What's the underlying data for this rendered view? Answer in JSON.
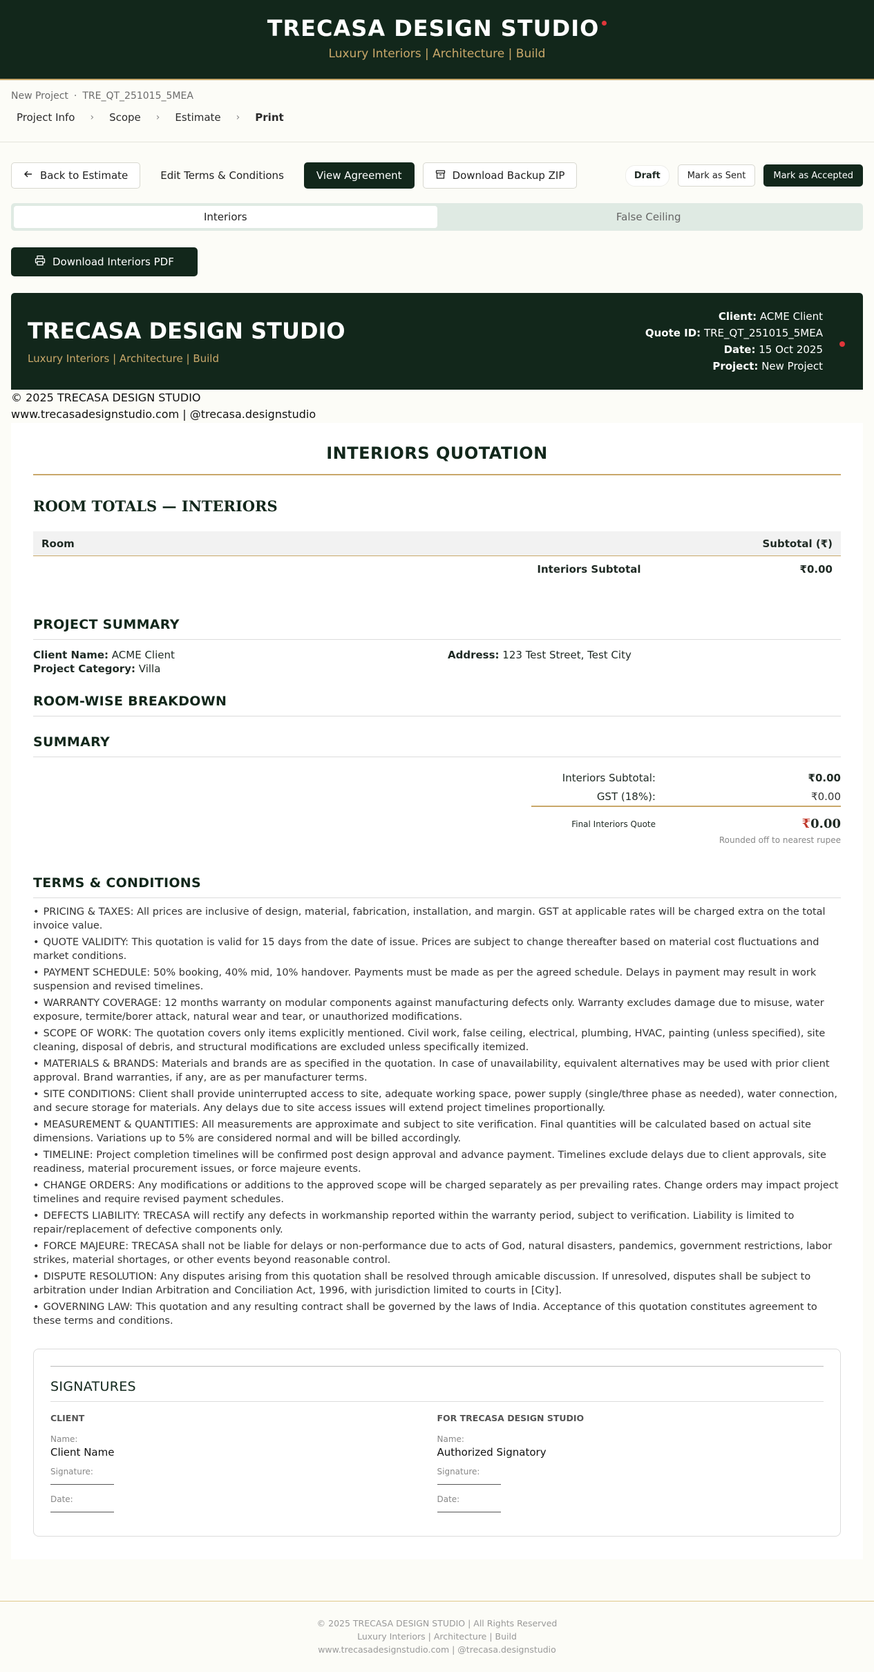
{
  "header": {
    "title": "TRECASA DESIGN STUDIO",
    "tagline": "Luxury Interiors | Architecture | Build"
  },
  "breadcrumb": {
    "project": "New Project",
    "separator": "·",
    "quote_id": "TRE_QT_251015_5MEA",
    "steps": [
      "Project Info",
      "Scope",
      "Estimate",
      "Print"
    ]
  },
  "toolbar": {
    "back": "Back to Estimate",
    "edit_terms": "Edit Terms & Conditions",
    "view_agreement": "View Agreement",
    "download_zip": "Download Backup ZIP",
    "status": "Draft",
    "mark_sent": "Mark as Sent",
    "mark_accepted": "Mark as Accepted"
  },
  "tabs": [
    "Interiors",
    "False Ceiling"
  ],
  "download_pdf": "Download Interiors PDF",
  "doc_header": {
    "title": "TRECASA DESIGN STUDIO",
    "tagline": "Luxury Interiors | Architecture | Build",
    "client_label": "Client:",
    "client": "ACME Client",
    "quote_label": "Quote ID:",
    "quote_id": "TRE_QT_251015_5MEA",
    "date_label": "Date:",
    "date": "15 Oct 2025",
    "project_label": "Project:",
    "project": "New Project",
    "copyright": "© 2025 TRECASA DESIGN STUDIO",
    "web": "www.trecasadesignstudio.com | @trecasa.designstudio"
  },
  "quote": {
    "title": "INTERIORS QUOTATION",
    "room_totals_heading": "ROOM TOTALS — INTERIORS",
    "col_room": "Room",
    "col_subtotal": "Subtotal (₹)",
    "subtotal_label": "Interiors Subtotal",
    "subtotal_value": "₹0.00"
  },
  "project_summary": {
    "title": "PROJECT SUMMARY",
    "client_name_label": "Client Name:",
    "client_name": "ACME Client",
    "category_label": "Project Category:",
    "category": "Villa",
    "address_label": "Address:",
    "address": "123 Test Street, Test City"
  },
  "room_breakdown": {
    "title": "ROOM-WISE BREAKDOWN"
  },
  "summary": {
    "title": "SUMMARY",
    "subtotal_label": "Interiors Subtotal:",
    "subtotal_value": "₹0.00",
    "gst_label": "GST (18%):",
    "gst_value": "₹0.00",
    "final_label": "Final Interiors Quote",
    "final_symbol": "₹",
    "final_value": "0.00",
    "rounded_note": "Rounded off to nearest rupee"
  },
  "terms": {
    "title": "TERMS & CONDITIONS",
    "items": [
      "PRICING & TAXES: All prices are inclusive of design, material, fabrication, installation, and margin. GST at applicable rates will be charged extra on the total invoice value.",
      "QUOTE VALIDITY: This quotation is valid for 15 days from the date of issue. Prices are subject to change thereafter based on material cost fluctuations and market conditions.",
      "PAYMENT SCHEDULE: 50% booking, 40% mid, 10% handover. Payments must be made as per the agreed schedule. Delays in payment may result in work suspension and revised timelines.",
      "WARRANTY COVERAGE: 12 months warranty on modular components against manufacturing defects only. Warranty excludes damage due to misuse, water exposure, termite/borer attack, natural wear and tear, or unauthorized modifications.",
      "SCOPE OF WORK: The quotation covers only items explicitly mentioned. Civil work, false ceiling, electrical, plumbing, HVAC, painting (unless specified), site cleaning, disposal of debris, and structural modifications are excluded unless specifically itemized.",
      "MATERIALS & BRANDS: Materials and brands are as specified in the quotation. In case of unavailability, equivalent alternatives may be used with prior client approval. Brand warranties, if any, are as per manufacturer terms.",
      "SITE CONDITIONS: Client shall provide uninterrupted access to site, adequate working space, power supply (single/three phase as needed), water connection, and secure storage for materials. Any delays due to site access issues will extend project timelines proportionally.",
      "MEASUREMENT & QUANTITIES: All measurements are approximate and subject to site verification. Final quantities will be calculated based on actual site dimensions. Variations up to 5% are considered normal and will be billed accordingly.",
      "TIMELINE: Project completion timelines will be confirmed post design approval and advance payment. Timelines exclude delays due to client approvals, site readiness, material procurement issues, or force majeure events.",
      "CHANGE ORDERS: Any modifications or additions to the approved scope will be charged separately as per prevailing rates. Change orders may impact project timelines and require revised payment schedules.",
      "DEFECTS LIABILITY: TRECASA will rectify any defects in workmanship reported within the warranty period, subject to verification. Liability is limited to repair/replacement of defective components only.",
      "FORCE MAJEURE: TRECASA shall not be liable for delays or non-performance due to acts of God, natural disasters, pandemics, government restrictions, labor strikes, material shortages, or other events beyond reasonable control.",
      "DISPUTE RESOLUTION: Any disputes arising from this quotation shall be resolved through amicable discussion. If unresolved, disputes shall be subject to arbitration under Indian Arbitration and Conciliation Act, 1996, with jurisdiction limited to courts in [City].",
      "GOVERNING LAW: This quotation and any resulting contract shall be governed by the laws of India. Acceptance of this quotation constitutes agreement to these terms and conditions."
    ]
  },
  "signatures": {
    "title": "SIGNATURES",
    "client_heading": "CLIENT",
    "studio_heading": "FOR TRECASA DESIGN STUDIO",
    "name_label": "Name:",
    "signature_label": "Signature:",
    "date_label": "Date:",
    "client_name": "Client Name",
    "studio_name": "Authorized Signatory"
  },
  "footer": {
    "line1": "© 2025 TRECASA DESIGN STUDIO | All Rights Reserved",
    "line2": "Luxury Interiors | Architecture | Build",
    "line3": "www.trecasadesignstudio.com | @trecasa.designstudio"
  },
  "colors": {
    "brand_dark": "#12271b",
    "gold": "#c9a86a",
    "accent_red": "#e0363a",
    "tab_bg": "#dfeae3"
  }
}
